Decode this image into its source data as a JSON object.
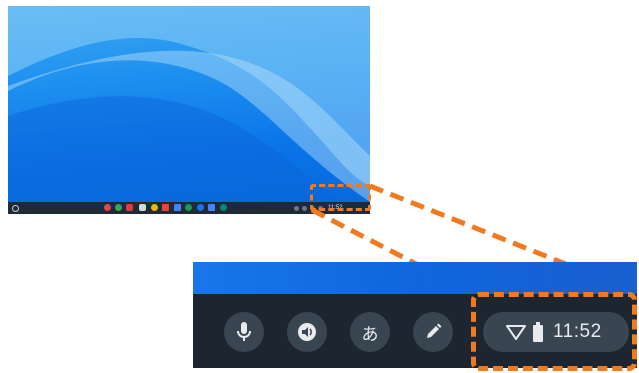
{
  "desktop": {
    "shelf": {
      "launcher_icon": "circle-launcher-icon",
      "apps": [
        {
          "name": "chrome-icon",
          "color": "#e8453c"
        },
        {
          "name": "play-store-icon",
          "color": "#34a853"
        },
        {
          "name": "youtube-icon",
          "color": "#e53935"
        },
        {
          "name": "camera-icon",
          "color": "#cfd8dc"
        },
        {
          "name": "google-photos-icon",
          "color": "#f4b400"
        },
        {
          "name": "gmail-icon",
          "color": "#ea4335"
        },
        {
          "name": "docs-icon",
          "color": "#4285f4"
        },
        {
          "name": "drive-icon",
          "color": "#0f9d58"
        },
        {
          "name": "duo-icon",
          "color": "#1a73e8"
        },
        {
          "name": "calendar-icon",
          "color": "#4285f4"
        },
        {
          "name": "meet-icon",
          "color": "#00897b"
        }
      ],
      "status": "11:52"
    }
  },
  "zoom": {
    "tray": {
      "mic_icon": "microphone-icon",
      "select_to_speak_icon": "select-to-speak-icon",
      "ime_label": "あ",
      "stylus_icon": "stylus-pen-icon"
    },
    "status": {
      "wifi_icon": "wifi-icon",
      "battery_icon": "battery-icon",
      "time": "11:52"
    }
  },
  "colors": {
    "highlight": "#f07a1d",
    "shelf": "#1d2531",
    "tray_button": "#3a4552"
  }
}
